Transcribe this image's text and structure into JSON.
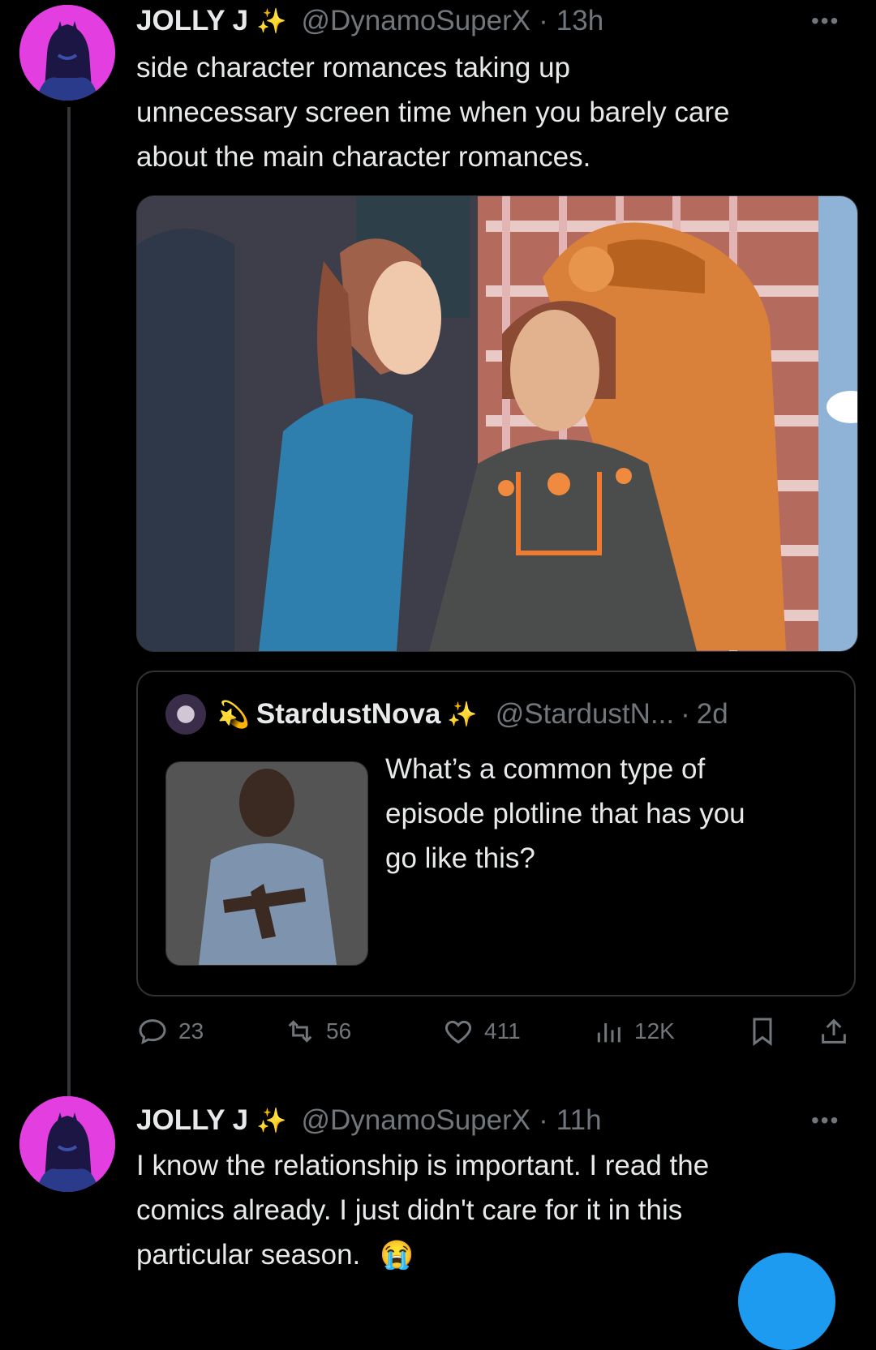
{
  "tweets": [
    {
      "display_name": "JOLLY J",
      "name_emoji": "✨",
      "handle": "@DynamoSuperX",
      "separator": "·",
      "time": "13h",
      "more": "•••",
      "text_lines": [
        "side character romances taking up",
        "unnecessary screen time when you barely care",
        "about the main character romances."
      ],
      "quoted": {
        "prefix_emoji": "💫",
        "display_name": "StardustNova",
        "name_emoji": "✨",
        "handle": "@StardustN...",
        "separator": "·",
        "time": "2d",
        "text_lines": [
          "What’s a common type of",
          "episode plotline that has you",
          "go like this?"
        ]
      },
      "actions": {
        "replies": "23",
        "retweets": "56",
        "likes": "411",
        "views": "12K"
      }
    },
    {
      "display_name": "JOLLY J",
      "name_emoji": "✨",
      "handle": "@DynamoSuperX",
      "separator": "·",
      "time": "11h",
      "more": "•••",
      "text_lines": [
        "I know the relationship is important. I read the",
        "comics already. I just didn't care for it in this",
        "particular season."
      ],
      "trailing_emoji": "😭"
    }
  ],
  "colors": {
    "background": "#000000",
    "text": "#e7e9ea",
    "muted": "#71767b",
    "border": "#2f3336",
    "accent_fab": "#1d9bf0"
  }
}
